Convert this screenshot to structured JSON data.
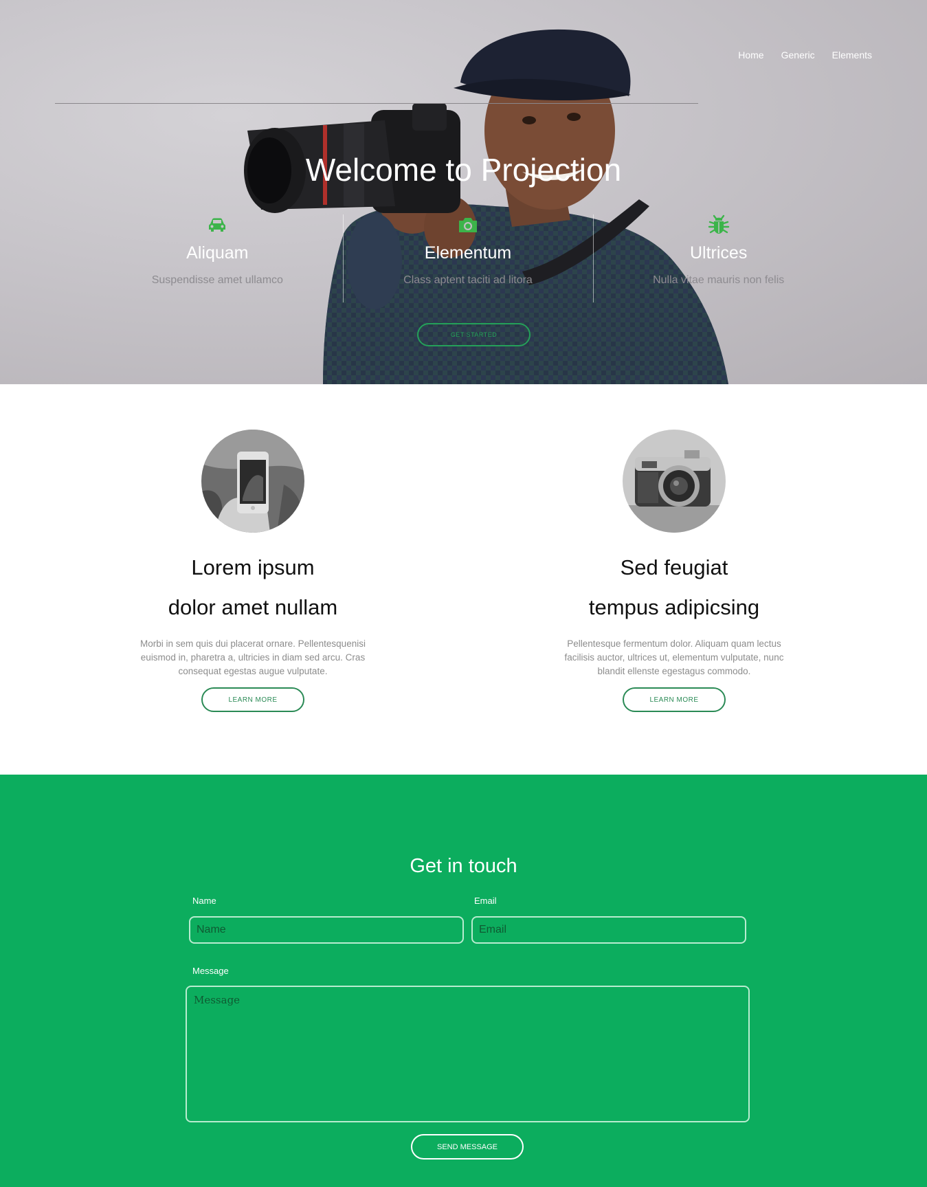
{
  "nav": {
    "items": [
      {
        "label": "Home"
      },
      {
        "label": "Generic"
      },
      {
        "label": "Elements"
      }
    ]
  },
  "hero": {
    "title": "Welcome to Projection",
    "features": [
      {
        "icon": "car-icon",
        "title": "Aliquam",
        "subtitle": "Suspendisse amet ullamco"
      },
      {
        "icon": "camera-icon",
        "title": "Elementum",
        "subtitle": "Class aptent taciti ad litora"
      },
      {
        "icon": "bug-icon",
        "title": "Ultrices",
        "subtitle": "Nulla vitae mauris non felis"
      }
    ],
    "cta_label": "Get Started",
    "accent": "#24a05a"
  },
  "spotlights": [
    {
      "image": "phone-photo",
      "heading_line1": "Lorem ipsum",
      "heading_line2": "dolor amet nullam",
      "text": "Morbi in sem quis dui placerat ornare. Pellentesquenisi euismod in, pharetra a, ultricies in diam sed arcu. Cras consequat egestas augue vulputate.",
      "button": "Learn More"
    },
    {
      "image": "camera-photo",
      "heading_line1": "Sed feugiat",
      "heading_line2": "tempus adipicsing",
      "text": "Pellentesque fermentum dolor. Aliquam quam lectus facilisis auctor, ultrices ut, elementum vulputate, nunc blandit ellenste egestagus commodo.",
      "button": "Learn More"
    }
  ],
  "contact": {
    "title": "Get in touch",
    "name_label": "Name",
    "name_placeholder": "Name",
    "email_label": "Email",
    "email_placeholder": "Email",
    "message_label": "Message",
    "message_placeholder": "Message",
    "submit": "Send Message",
    "background": "#0cad5e"
  }
}
